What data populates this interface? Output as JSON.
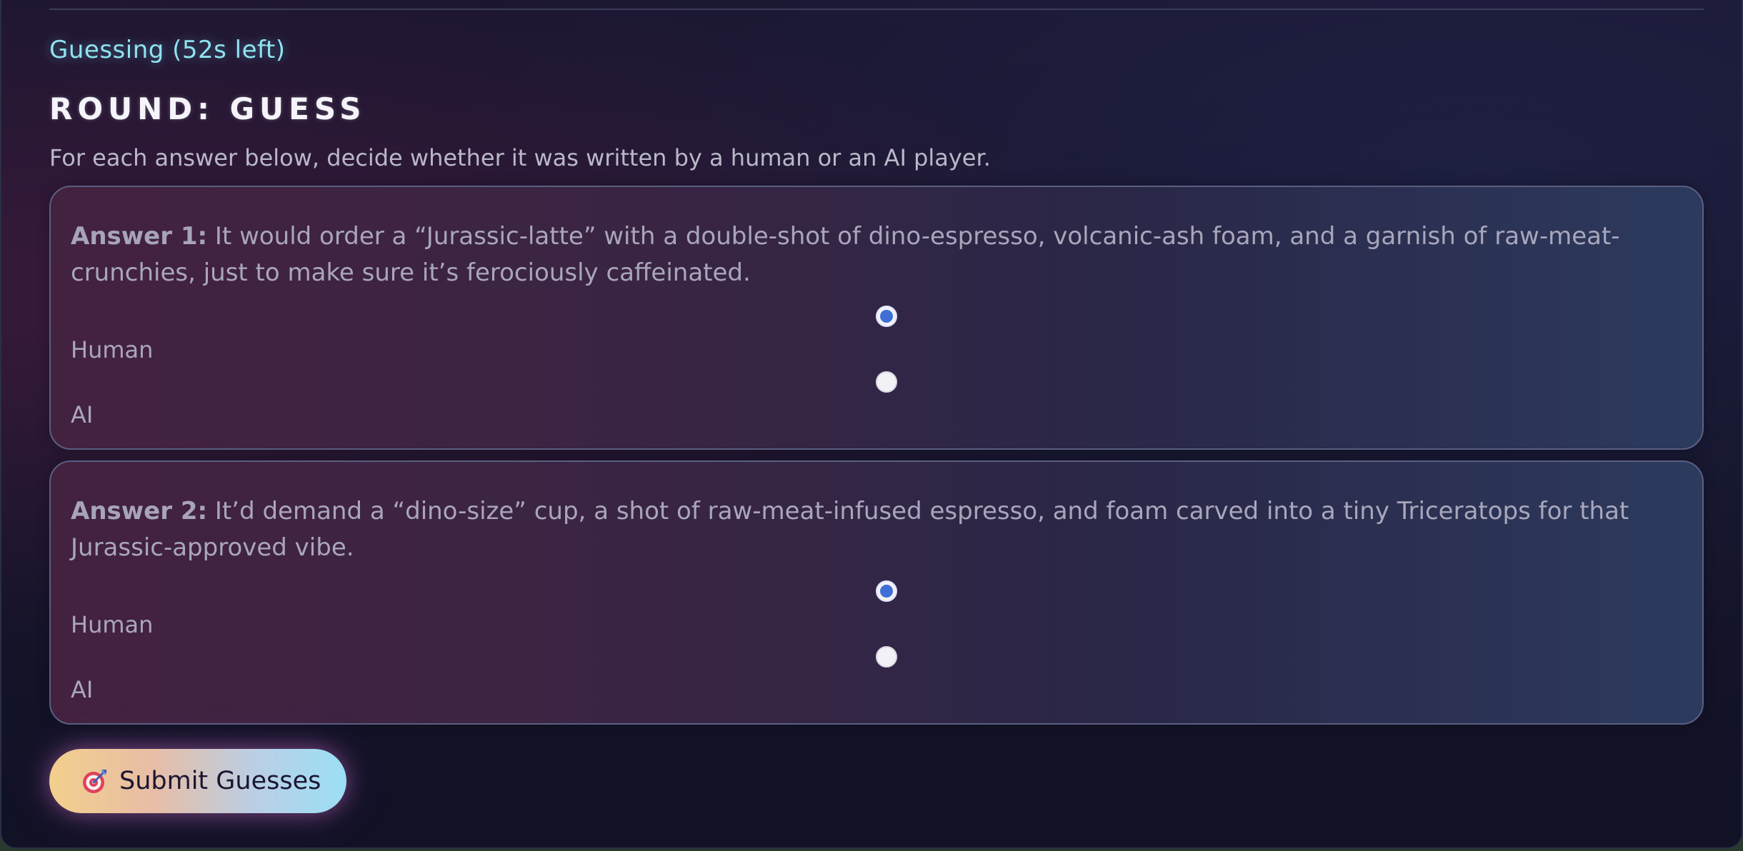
{
  "status": {
    "text": "Guessing (52s left)",
    "color": "#8fe2f0"
  },
  "round": {
    "title": "ROUND: GUESS",
    "instructions": "For each answer below, decide whether it was written by a human or an AI player."
  },
  "answers": [
    {
      "label": "Answer 1:",
      "text": " It would order a “Jurassic-latte” with a double-shot of dino-espresso, volcanic-ash foam, and a garnish of raw-meat-crunchies, just to make sure it’s ferociously caffeinated.",
      "options": [
        "Human",
        "AI"
      ],
      "selected": "Human"
    },
    {
      "label": "Answer 2:",
      "text": " It’d demand a “dino-size” cup, a shot of raw-meat-infused espresso, and foam carved into a tiny Triceratops for that Jurassic-approved vibe.",
      "options": [
        "Human",
        "AI"
      ],
      "selected": "Human"
    }
  ],
  "submit": {
    "label": "Submit Guesses",
    "icon": "target-icon"
  },
  "colors": {
    "accent_radio": "#3f6fd6",
    "button_gradient_start": "#f2cf8c",
    "button_gradient_end": "#9bdff5"
  }
}
